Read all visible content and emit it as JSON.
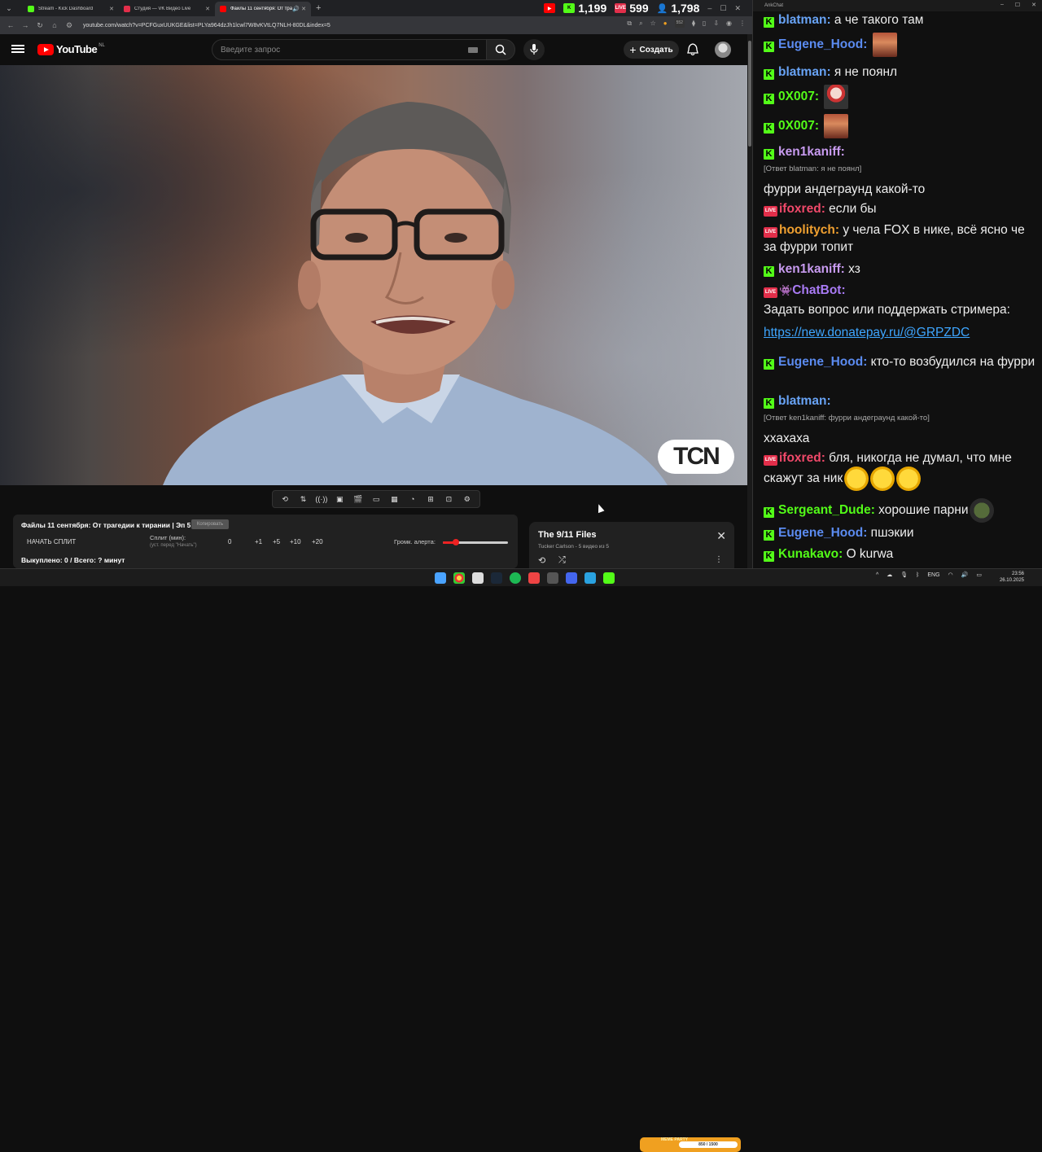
{
  "browser": {
    "tabs": [
      {
        "title": "Stream - Kick Dashboard",
        "color": "#53fc18"
      },
      {
        "title": "Студия — VK Видео Live",
        "color": "#e22e4a"
      },
      {
        "title": "Файлы 11 сентября: От тра",
        "color": "#ff0000"
      }
    ],
    "url": "youtube.com/watch?v=PCFGuxUUKGE&list=PLYa964dzJh1lcwl7W8vKVtLQ7NLH-80DL&index=5",
    "stats": {
      "kick": "1,199",
      "vk": "599",
      "followers": "1,798"
    },
    "ext_badge": "552"
  },
  "youtube": {
    "logo_text": "YouTube",
    "country": "NL",
    "search_placeholder": "Введите запрос",
    "create_label": "Создать",
    "watermark": "TCN"
  },
  "split_panel": {
    "video_title": "Файлы 11 сентября: От трагедии к тирании | Эп 5",
    "badge": "Копировать",
    "start_split": "НАЧАТЬ СПЛИТ",
    "split_label": "Сплит (мин):",
    "split_sub": "(уст. перед \"Начать\")",
    "split_value": "0",
    "buttons": [
      "+1",
      "+5",
      "+10",
      "+20"
    ],
    "alert_volume_label": "Громк. алерта:",
    "alert_volume": 0.2,
    "bought": "Выкуплено: 0 / Всего: ? минут"
  },
  "playlist": {
    "title": "The 9/11 Files",
    "subtitle": "Tucker Carlson - 5 видео из 5"
  },
  "chat": {
    "window_title": "AnkChat",
    "messages": [
      {
        "platform": "kick",
        "user": "blatman",
        "color": "#68a3f5",
        "text": "а че такого там"
      },
      {
        "platform": "kick",
        "user": "Eugene_Hood",
        "color": "#5b8bf0",
        "text": "",
        "emote": "emote-face"
      },
      {
        "platform": "kick",
        "user": "blatman",
        "color": "#68a3f5",
        "text": "я не поянл"
      },
      {
        "platform": "kick",
        "user": "0X007",
        "color": "#53fc18",
        "text": "",
        "emote": "emote-cat"
      },
      {
        "platform": "kick",
        "user": "0X007",
        "color": "#53fc18",
        "text": "",
        "emote": "emote-face"
      },
      {
        "platform": "kick",
        "user": "ken1kaniff",
        "color": "#c89bf0",
        "text": "",
        "reply": "[Ответ blatman: я не поянл]",
        "second": "фурри андеграунд какой-то"
      },
      {
        "platform": "live",
        "user": "ifoxred",
        "color": "#f0496a",
        "text": "если бы"
      },
      {
        "platform": "live",
        "user": "hoolitych",
        "color": "#f0a030",
        "text": "у чела FOX в нике, всё ясно че за фурри топит"
      },
      {
        "platform": "kick",
        "user": "ken1kaniff",
        "color": "#c89bf0",
        "text": "хз"
      },
      {
        "platform": "live",
        "user": "ChatBot",
        "color": "#a97bf5",
        "text": "",
        "second": "Задать вопрос или поддержать стримера:",
        "link": "https://new.donatepay.ru/@GRPZDC"
      },
      {
        "platform": "kick",
        "user": "Eugene_Hood",
        "color": "#5b8bf0",
        "text": "кто-то возбудился на фурри"
      },
      {
        "platform": "kick",
        "user": "blatman",
        "color": "#68a3f5",
        "text": "",
        "reply": "[Ответ ken1kaniff: фурри андеграунд какой-то]",
        "second": "ххахаха"
      },
      {
        "platform": "live",
        "user": "ifoxred",
        "color": "#f0496a",
        "text": "бля, никогда не думал, что мне скажут за ник"
      },
      {
        "platform": "kick",
        "user": "Sergeant_Dude",
        "color": "#53fc18",
        "text": "хорошие парни"
      },
      {
        "platform": "kick",
        "user": "Eugene_Hood",
        "color": "#5b8bf0",
        "text": "пшэкии"
      },
      {
        "platform": "kick",
        "user": "Kunakavo",
        "color": "#53fc18",
        "text": "O kurwa"
      }
    ]
  },
  "taskbar": {
    "meme_title": "MEME PARTY",
    "meme_progress": "850 / 1500",
    "lang": "ENG",
    "time": "23:56",
    "date": "26.10.2025"
  }
}
